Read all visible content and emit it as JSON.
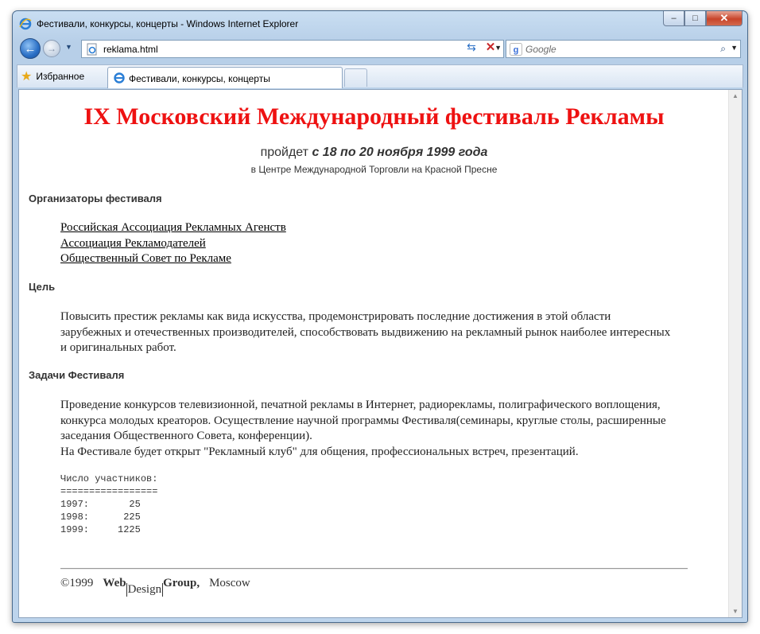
{
  "window": {
    "title": "Фестивали, конкурсы, концерты - Windows Internet Explorer",
    "buttons": {
      "minimize": "–",
      "maximize": "□",
      "close": "✕"
    }
  },
  "navbar": {
    "address": "reklama.html",
    "search_placeholder": "Google"
  },
  "tabs": {
    "favorites_label": "Избранное",
    "active_tab": "Фестивали, конкурсы, концерты"
  },
  "page": {
    "heading": "IX Московский Международный фестиваль Рекламы",
    "subtitle_prefix": "пройдет",
    "subtitle_dates": "с 18 по 20 ноября 1999 года",
    "venue": "в Центре Международной Торговли на Красной Пресне",
    "organizers_heading": "Организаторы фестиваля",
    "organizers": [
      "Российская Ассоциация Рекламных Агенств",
      "Ассоциация Рекламодателей",
      "Общественный Совет по Рекламе"
    ],
    "goal_heading": "Цель",
    "goal_text": "Повысить престиж рекламы как вида искусства, продемонстрировать последние достижения в этой области зарубежных и отечественных производителей, способствовать выдвижению на рекламный рынок наиболее интересных и оригинальных работ.",
    "tasks_heading": "Задачи Фестиваля",
    "tasks_text": "Проведение конкурсов телевизионной, печатной рекламы в Интернет, радиорекламы, полиграфического воплощения, конкурса молодых креаторов. Осуществление научной программы Фестиваля(семинары, круглые столы, расширенные заседания Общественного Совета, конференции).",
    "club_text": "На Фестивале будет открыт \"Рекламный клуб\" для общения, профессиональных встреч, презентаций.",
    "participants_block": "Число участников:\n=================\n1997:       25\n1998:      225\n1999:     1225",
    "footer": {
      "copyright": "©1999",
      "web": "Web",
      "design": "Design",
      "group": "Group,",
      "city": "Moscow"
    }
  }
}
